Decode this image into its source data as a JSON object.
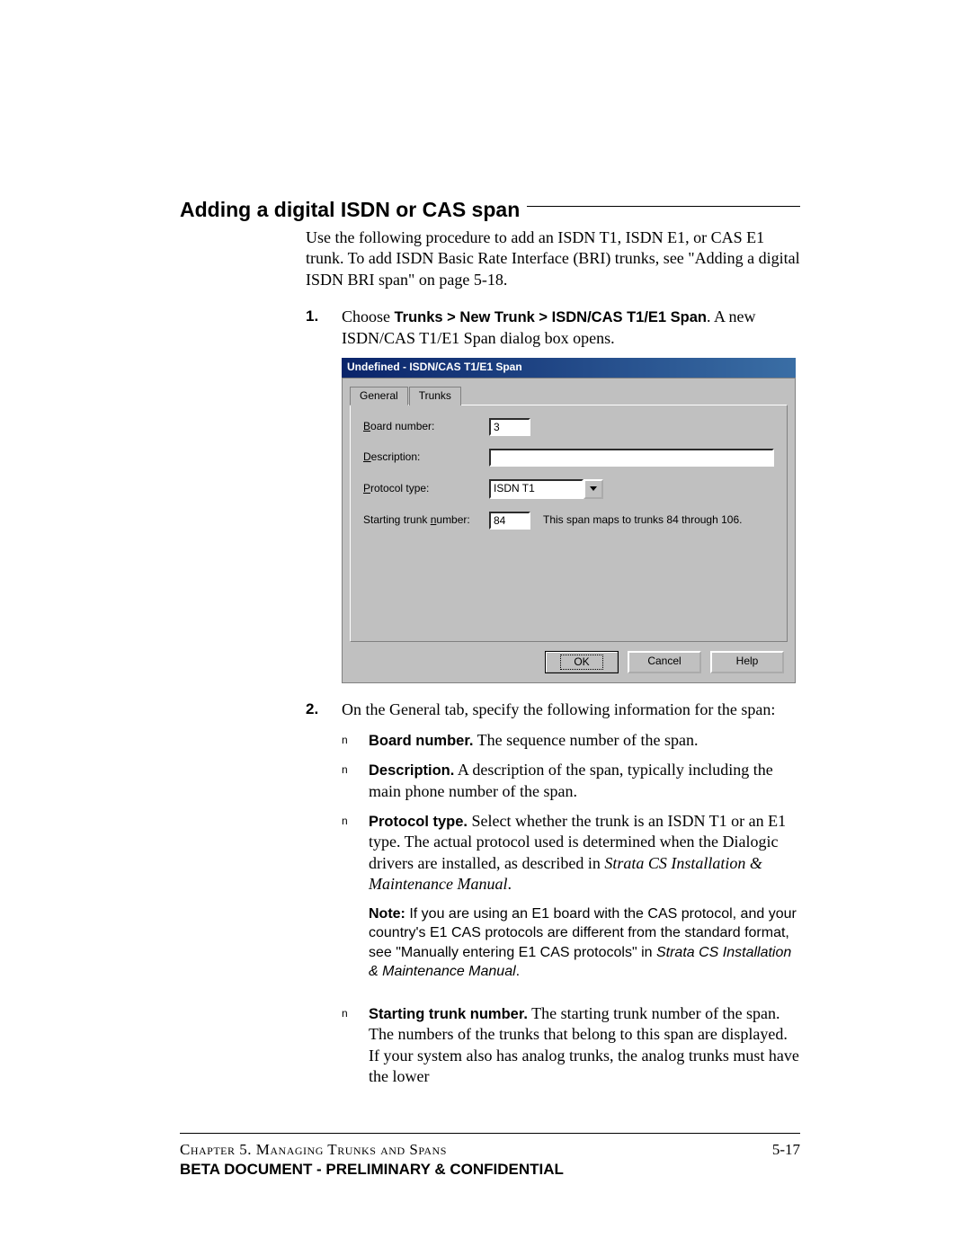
{
  "heading": "Adding a digital ISDN or CAS span",
  "intro": "Use the following procedure to add an ISDN T1, ISDN E1, or CAS E1 trunk. To add ISDN Basic Rate Interface (BRI) trunks, see \"Adding a digital ISDN BRI span\" on page 5-18.",
  "step1": {
    "num": "1.",
    "lead": "Choose ",
    "bold": "Trunks > New Trunk > ISDN/CAS T1/E1 Span",
    "tail": ". A new ISDN/CAS T1/E1 Span dialog box opens."
  },
  "dialog": {
    "title": "Undefined - ISDN/CAS T1/E1 Span",
    "tabs": {
      "general": "General",
      "trunks": "Trunks"
    },
    "fields": {
      "board_label": "Board number:",
      "board_value": "3",
      "desc_label": "Description:",
      "desc_value": "",
      "proto_label": "Protocol type:",
      "proto_value": "ISDN T1",
      "start_label": "Starting trunk number:",
      "start_value": "84",
      "start_hint": "This span maps to trunks 84 through 106."
    },
    "buttons": {
      "ok": "OK",
      "cancel": "Cancel",
      "help": "Help"
    }
  },
  "step2": {
    "num": "2.",
    "text": "On the General tab, specify the following information for the span:"
  },
  "bullets": {
    "board": {
      "label": "Board number.",
      "text": " The sequence number of the span."
    },
    "desc": {
      "label": "Description.",
      "text": " A description of the span, typically including the main phone number of the span."
    },
    "proto": {
      "label": "Protocol type.",
      "text": " Select whether the trunk is an ISDN T1 or an E1 type. The actual protocol used is determined when the Dialogic drivers are installed, as described in ",
      "ital": "Strata CS Installation & Maintenance Manual",
      "tail": "."
    },
    "note": {
      "label": "Note:",
      "text": "  If you are using an E1 board with the CAS protocol, and your country's E1 CAS protocols are different from the standard format, see \"Manually entering E1 CAS protocols\" in ",
      "ital": "Strata CS Installation & Maintenance Manual",
      "tail": "."
    },
    "start": {
      "label": "Starting trunk number.",
      "text": " The starting trunk number of the span. The numbers of the trunks that belong to this span are displayed. If your system also has analog trunks, the analog trunks must have the lower"
    }
  },
  "footer": {
    "chapter": "Chapter 5. Managing Trunks and Spans",
    "pagenum": "5-17",
    "confidential": "BETA DOCUMENT - PRELIMINARY & CONFIDENTIAL"
  }
}
